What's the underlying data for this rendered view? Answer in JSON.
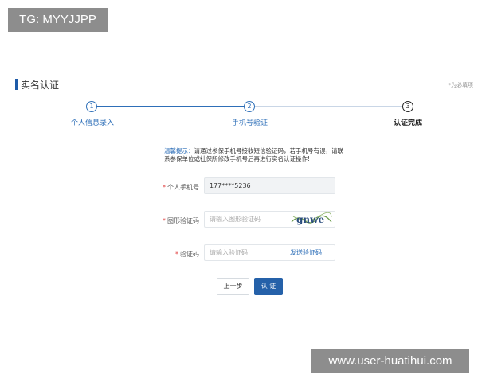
{
  "watermarks": {
    "top": "TG: MYYJJPP",
    "bottom": "www.user-huatihui.com"
  },
  "header": {
    "title": "实名认证",
    "note": "*为必填项"
  },
  "steps": [
    {
      "number": "1",
      "label": "个人信息录入",
      "state": "done"
    },
    {
      "number": "2",
      "label": "手机号验证",
      "state": "current"
    },
    {
      "number": "3",
      "label": "认证完成",
      "state": "pending"
    }
  ],
  "tip": {
    "head": "温馨提示：",
    "body": "请通过参保手机号接收短信验证码，若手机号有误，请联系参保单位或社保所修改手机号后再进行实名认证操作!"
  },
  "form": {
    "phone": {
      "label": "个人手机号",
      "value": "177****5236"
    },
    "image_code": {
      "label": "图形验证码",
      "placeholder": "请输入图形验证码",
      "captcha_text": "gnwe"
    },
    "sms_code": {
      "label": "验证码",
      "placeholder": "请输入验证码",
      "send_label": "发送验证码"
    },
    "required_mark": "*"
  },
  "buttons": {
    "prev": "上一步",
    "confirm": "认 证"
  },
  "colors": {
    "accent": "#2561a9",
    "required": "#e03c3c"
  }
}
